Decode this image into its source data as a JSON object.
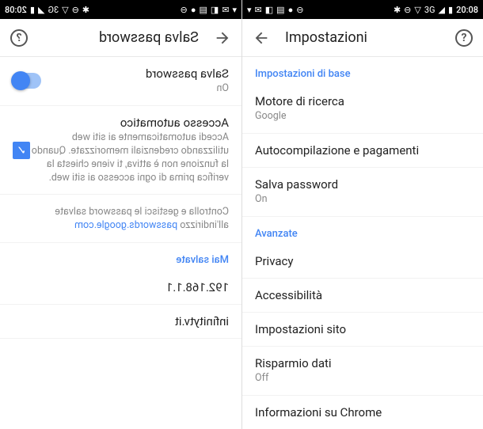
{
  "status": {
    "time": "20:08",
    "signal": "3G"
  },
  "right_panel": {
    "title": "Impostazioni",
    "sections": {
      "basic": {
        "header": "Impostazioni di base",
        "search_engine": {
          "title": "Motore di ricerca",
          "sub": "Google"
        },
        "autofill": {
          "title": "Autocompilazione e pagamenti"
        },
        "save_password": {
          "title": "Salva password",
          "sub": "On"
        }
      },
      "advanced": {
        "header": "Avanzate",
        "privacy": {
          "title": "Privacy"
        },
        "accessibility": {
          "title": "Accessibilità"
        },
        "site_settings": {
          "title": "Impostazioni sito"
        },
        "data_saver": {
          "title": "Risparmio dati",
          "sub": "Off"
        },
        "about": {
          "title": "Informazioni su Chrome"
        }
      }
    }
  },
  "left_panel": {
    "title": "Salva password",
    "save_password": {
      "title": "Salva password",
      "sub": "On"
    },
    "auto_signin": {
      "title": "Accesso automatico",
      "sub": "Accedi automaticamente ai siti web utilizzando credenziali memorizzate. Quando la funzione non è attiva, ti viene chiesta la verifica prima di ogni accesso ai siti web."
    },
    "manage": {
      "text": "Controlla e gestisci le password salvate all'indirizzo ",
      "link": "passwords.google.com"
    },
    "never_saved_header": "Mai salvate",
    "entries": {
      "ip": "192.168.1.1",
      "site": "infinitytv.it"
    }
  }
}
